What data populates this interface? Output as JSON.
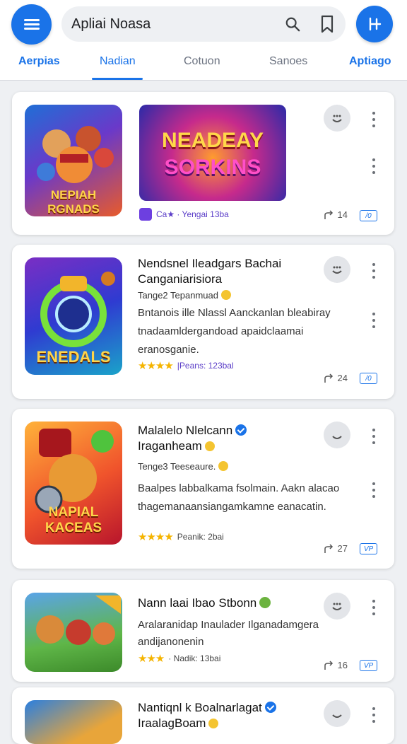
{
  "search": {
    "value": "Apliai Noasa"
  },
  "tabs": [
    {
      "label": "Aerpias"
    },
    {
      "label": "Nadian"
    },
    {
      "label": "Cotuon"
    },
    {
      "label": "Sanoes"
    },
    {
      "label": "Aptiago"
    }
  ],
  "icons": {
    "menu": "hamburger-menu-icon",
    "search": "search-icon",
    "bookmark": "bookmark-icon",
    "fab": "add-icon",
    "react": "smiley-icon",
    "more": "more-vert-icon",
    "share": "share-icon",
    "tag": "tag-icon"
  },
  "colors": {
    "accent": "#1a73e8",
    "star": "#f5b400",
    "rating": "#5b3ec8"
  },
  "cards": [
    {
      "thumb_caption": "NEPIAH RGNADS",
      "banner_text_line1": "NEADEAY",
      "banner_text_line2": "SORKINS",
      "meta_text": "Ca★ · Yengai 13ba",
      "share_count": "14",
      "badge": "/0"
    },
    {
      "title": "Nendsnel Ileadgars Bachai Canganiarisiora",
      "sub": "Tange2 Tepanmuad",
      "desc": "Bntanois ille Nlassl Aanckanlan bleabiray tnadaamldergandoad apaidclaamai eranosganie.",
      "stars": "★★★★",
      "rating_text": "|Peans: 123bal",
      "share_count": "24",
      "badge": "/0",
      "thumb_caption": "ENEDALS"
    },
    {
      "title": "Malalelo Nlelcann",
      "title2": "Iraganheam",
      "sub": "Tenge3 Teeseaure.",
      "desc": "Baalpes labbalkama fsolmain. Aakn alacao thagemanaansiangamkamne eanacatin.",
      "stars": "★★★★",
      "rating_text": "Peanik: 2bai",
      "share_count": "27",
      "badge": "VP",
      "thumb_caption": "NAPIAL KACEAS"
    },
    {
      "title": "Nann laai Ibao Stbonn",
      "desc": "Aralaranidap Inaulader Ilganadamgera andijanonenin",
      "stars": "★★★",
      "rating_text": "· Nadik: 13bai",
      "share_count": "16",
      "badge": "VP"
    },
    {
      "title": "Nantiqnl k Boalnarlagat",
      "title2": "IraalagBoam"
    }
  ]
}
